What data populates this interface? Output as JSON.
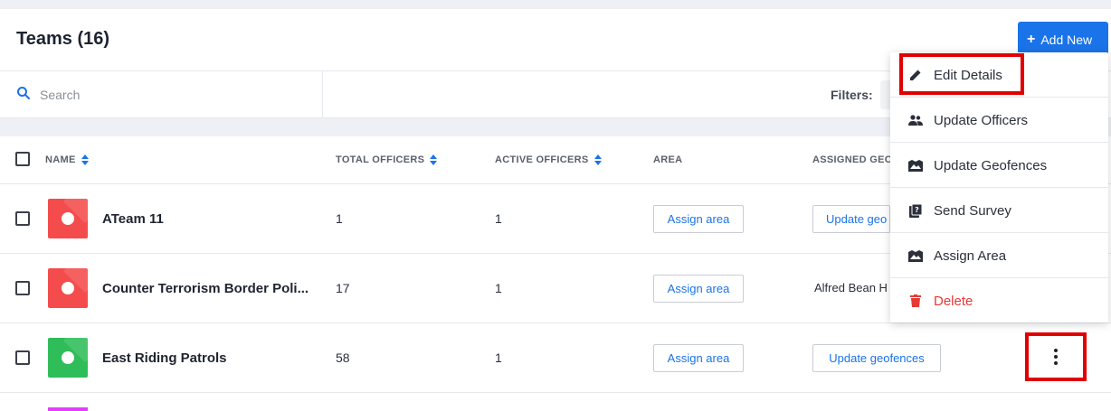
{
  "header": {
    "title": "Teams (16)",
    "add_button": "Add New"
  },
  "search": {
    "placeholder": "Search"
  },
  "filters_label": "Filters:",
  "columns": {
    "name": "NAME",
    "total_officers": "TOTAL OFFICERS",
    "active_officers": "ACTIVE OFFICERS",
    "area": "AREA",
    "assigned_geofences": "ASSIGNED GEO"
  },
  "rows": [
    {
      "name": "ATeam 11",
      "total": "1",
      "active": "1",
      "area_button": "Assign area",
      "geofence_button": "Update geo",
      "color": "#f44c4c"
    },
    {
      "name": "Counter Terrorism Border Poli...",
      "total": "17",
      "active": "1",
      "area_button": "Assign area",
      "geofence_text": "Alfred Bean H",
      "color": "#f44c4c"
    },
    {
      "name": "East Riding Patrols",
      "total": "58",
      "active": "1",
      "area_button": "Assign area",
      "geofence_button": "Update geofences",
      "color": "#2ebd59"
    }
  ],
  "menu": {
    "items": [
      {
        "label": "Edit Details",
        "icon": "pencil-icon"
      },
      {
        "label": "Update Officers",
        "icon": "people-icon"
      },
      {
        "label": "Update Geofences",
        "icon": "map-icon"
      },
      {
        "label": "Send Survey",
        "icon": "survey-icon"
      },
      {
        "label": "Assign Area",
        "icon": "map-icon"
      },
      {
        "label": "Delete",
        "icon": "trash-icon"
      }
    ]
  },
  "colors": {
    "accent": "#1a73e8",
    "highlight": "#e00000",
    "delete": "#e53935"
  }
}
